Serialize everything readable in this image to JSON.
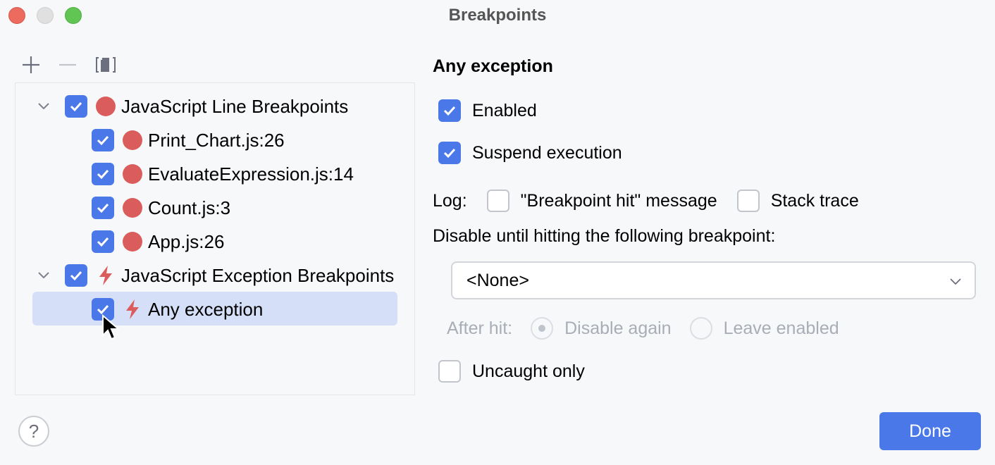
{
  "window": {
    "title": "Breakpoints",
    "controls": [
      "close",
      "minimize",
      "maximize"
    ]
  },
  "toolbar": {
    "add_icon": "plus-icon",
    "remove_icon": "minus-icon",
    "group_icon": "group-by-file-icon"
  },
  "tree": {
    "groups": [
      {
        "label": "JavaScript Line Breakpoints",
        "checked": true,
        "expanded": true,
        "icon": "breakpoint-dot-icon",
        "items": [
          {
            "label": "Print_Chart.js:26",
            "checked": true,
            "icon": "breakpoint-dot-icon"
          },
          {
            "label": "EvaluateExpression.js:14",
            "checked": true,
            "icon": "breakpoint-dot-icon"
          },
          {
            "label": "Count.js:3",
            "checked": true,
            "icon": "breakpoint-dot-icon"
          },
          {
            "label": "App.js:26",
            "checked": true,
            "icon": "breakpoint-dot-icon"
          }
        ]
      },
      {
        "label": "JavaScript Exception Breakpoints",
        "checked": true,
        "expanded": true,
        "icon": "exception-bolt-icon",
        "items": [
          {
            "label": "Any exception",
            "checked": true,
            "selected": true,
            "icon": "exception-bolt-icon"
          }
        ]
      }
    ]
  },
  "details": {
    "title": "Any exception",
    "enabled_label": "Enabled",
    "enabled": true,
    "suspend_label": "Suspend execution",
    "suspend": true,
    "log_label": "Log:",
    "log_message_label": "\"Breakpoint hit\" message",
    "log_message": false,
    "stack_trace_label": "Stack trace",
    "stack_trace": false,
    "disable_until_label": "Disable until hitting the following breakpoint:",
    "disable_until_value": "<None>",
    "after_hit_label": "After hit:",
    "after_hit_options": [
      "Disable again",
      "Leave enabled"
    ],
    "after_hit_selected": "Disable again",
    "uncaught_label": "Uncaught only",
    "uncaught": false
  },
  "footer": {
    "help_label": "?",
    "done_label": "Done"
  },
  "colors": {
    "accent": "#4a78e8",
    "breakpoint": "#db5c5c",
    "selection": "#d5e0f8",
    "background": "#f7f8fa"
  }
}
